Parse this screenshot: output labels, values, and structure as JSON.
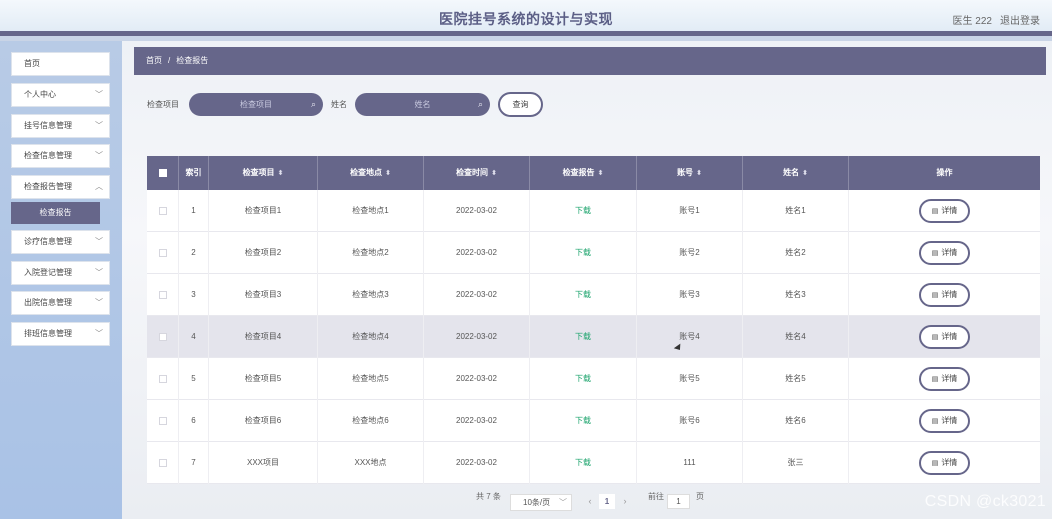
{
  "header": {
    "title": "医院挂号系统的设计与实现",
    "user": "医生 222",
    "logout": "退出登录"
  },
  "sidebar": {
    "items": [
      {
        "label": "首页",
        "has_arrow": false
      },
      {
        "label": "个人中心",
        "has_arrow": true
      },
      {
        "label": "挂号信息管理",
        "has_arrow": true
      },
      {
        "label": "检查信息管理",
        "has_arrow": true
      },
      {
        "label": "检查报告管理",
        "has_arrow": true
      },
      {
        "label": "诊疗信息管理",
        "has_arrow": true
      },
      {
        "label": "入院登记管理",
        "has_arrow": true
      },
      {
        "label": "出院信息管理",
        "has_arrow": true
      },
      {
        "label": "排班信息管理",
        "has_arrow": true
      }
    ],
    "active_submenu": "检查报告"
  },
  "breadcrumb": {
    "home": "首页",
    "separator": "/",
    "current": "检查报告"
  },
  "search": {
    "item_label": "检查项目",
    "item_placeholder": "检查项目",
    "name_label": "姓名",
    "name_placeholder": "姓名",
    "query_button": "查询"
  },
  "table": {
    "columns": [
      "索引",
      "检查项目",
      "检查地点",
      "检查时间",
      "检查报告",
      "账号",
      "姓名",
      "操作"
    ],
    "detail_label": "详情",
    "rows": [
      {
        "index": "1",
        "item": "检查项目1",
        "place": "检查地点1",
        "time": "2022-03-02",
        "report": "下载",
        "account": "账号1",
        "name": "姓名1"
      },
      {
        "index": "2",
        "item": "检查项目2",
        "place": "检查地点2",
        "time": "2022-03-02",
        "report": "下载",
        "account": "账号2",
        "name": "姓名2"
      },
      {
        "index": "3",
        "item": "检查项目3",
        "place": "检查地点3",
        "time": "2022-03-02",
        "report": "下载",
        "account": "账号3",
        "name": "姓名3"
      },
      {
        "index": "4",
        "item": "检查项目4",
        "place": "检查地点4",
        "time": "2022-03-02",
        "report": "下载",
        "account": "账号4",
        "name": "姓名4"
      },
      {
        "index": "5",
        "item": "检查项目5",
        "place": "检查地点5",
        "time": "2022-03-02",
        "report": "下载",
        "account": "账号5",
        "name": "姓名5"
      },
      {
        "index": "6",
        "item": "检查项目6",
        "place": "检查地点6",
        "time": "2022-03-02",
        "report": "下载",
        "account": "账号6",
        "name": "姓名6"
      },
      {
        "index": "7",
        "item": "XXX项目",
        "place": "XXX地点",
        "time": "2022-03-02",
        "report": "下载",
        "account": "111",
        "name": "张三"
      }
    ],
    "highlighted_row": 4
  },
  "pagination": {
    "total": "共 7 条",
    "page_size": "10条/页",
    "prev": "‹",
    "current_page": "1",
    "next": "›",
    "goto_label": "前往",
    "goto_value": "1",
    "page_suffix": "页"
  },
  "watermark": "CSDN @ck3021",
  "colors": {
    "primary": "#66668a",
    "download": "#1aa36b"
  }
}
